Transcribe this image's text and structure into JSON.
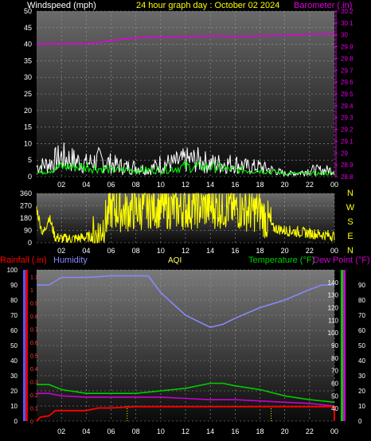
{
  "header": {
    "left": "Windspeed (mph)",
    "center": "24 hour graph day : October 02 2024",
    "right": "Barometer (.in)"
  },
  "mid_header": {
    "rainfall": "Rainfall (.in)",
    "humidity": "Humidity",
    "aqi": "AQI",
    "temperature": "Temperature (°F)",
    "dewpoint": "Dew Point (°F)"
  },
  "colors": {
    "windspeed": "#ffffff",
    "gust": "#00ff00",
    "barometer": "#e000e0",
    "direction": "#ffff00",
    "temperature": "#00cc00",
    "dewpoint": "#cc00cc",
    "humidity": "#8888ff",
    "rain": "#ff0000",
    "aqi": "#ffff00"
  },
  "chart_data": [
    {
      "type": "line",
      "name": "wind-baro",
      "title": "24 hour graph day : October 02 2024",
      "x_ticks": [
        "02",
        "04",
        "06",
        "08",
        "10",
        "12",
        "14",
        "16",
        "18",
        "20",
        "22",
        "00"
      ],
      "left_axis": {
        "label": "Windspeed (mph)",
        "range": [
          0,
          50
        ],
        "ticks": [
          "0",
          "5",
          "10",
          "15",
          "20",
          "25",
          "30",
          "35",
          "40",
          "45",
          "50"
        ]
      },
      "right_axis": {
        "label": "Barometer (.in)",
        "range": [
          28.8,
          30.2
        ],
        "ticks": [
          "28.8",
          "28.9",
          "29",
          "29.1",
          "29.2",
          "29.3",
          "29.4",
          "29.5",
          "29.6",
          "29.7",
          "29.8",
          "29.9",
          "30",
          "30.1",
          "30.2"
        ]
      },
      "series": [
        {
          "axis": "right",
          "hours": [
            0,
            2,
            4,
            6,
            8,
            10,
            12,
            14,
            16,
            18,
            20,
            22,
            24
          ],
          "values": [
            29.92,
            29.925,
            29.925,
            29.95,
            29.975,
            29.98,
            29.985,
            29.99,
            29.985,
            29.99,
            29.995,
            30.005,
            30.01
          ]
        },
        {
          "axis": "left",
          "hours": [
            0,
            1,
            2,
            3,
            4,
            5,
            6,
            7,
            8,
            9,
            10,
            11,
            12,
            13,
            14,
            15,
            16,
            17,
            18,
            19,
            20,
            21,
            22,
            23,
            24
          ],
          "values": [
            3,
            4,
            6,
            5,
            4,
            5,
            4,
            3,
            3,
            2,
            4,
            4,
            5,
            5,
            4,
            4,
            4,
            3,
            3,
            2,
            1,
            1,
            2,
            2,
            2
          ]
        },
        {
          "axis": "left",
          "hours": [
            0,
            2,
            4,
            6,
            8,
            10,
            12,
            14,
            16,
            18,
            20,
            22,
            24
          ],
          "values": [
            1,
            3,
            3,
            2,
            2,
            2,
            3,
            3,
            2,
            2,
            1,
            1,
            1
          ]
        }
      ]
    },
    {
      "type": "line",
      "name": "wind-direction",
      "left_axis": {
        "range": [
          0,
          360
        ],
        "ticks": [
          "0",
          "90",
          "180",
          "270",
          "360"
        ]
      },
      "right_labels": [
        "N",
        "W",
        "S",
        "E",
        "N"
      ],
      "x_ticks": [
        "02",
        "04",
        "06",
        "08",
        "10",
        "12",
        "14",
        "16",
        "18",
        "20",
        "22",
        "00"
      ],
      "series": [
        {
          "hours": [
            0,
            0.5,
            1,
            1.5,
            2,
            3,
            4,
            5,
            6,
            7,
            8,
            9,
            10,
            11,
            12,
            13,
            14,
            15,
            16,
            17,
            18,
            19,
            20,
            21,
            22,
            23,
            24
          ],
          "values": [
            250,
            60,
            190,
            40,
            30,
            30,
            40,
            60,
            250,
            230,
            240,
            260,
            260,
            250,
            250,
            260,
            260,
            255,
            250,
            240,
            230,
            110,
            90,
            80,
            70,
            60,
            50
          ]
        }
      ]
    },
    {
      "type": "line",
      "name": "temp-humidity-rain",
      "x_ticks": [
        "02",
        "04",
        "06",
        "08",
        "10",
        "12",
        "14",
        "16",
        "18",
        "20",
        "22",
        "00"
      ],
      "humidity_axis": {
        "label": "Humidity",
        "range": [
          0,
          100
        ],
        "ticks": [
          "0",
          "10",
          "20",
          "30",
          "40",
          "50",
          "60",
          "70",
          "80",
          "90",
          "100"
        ]
      },
      "rain_axis": {
        "label": "Rainfall (.in)",
        "range": [
          0,
          1.15
        ],
        "ticks": [
          "0",
          "0.1",
          "0.2",
          "0.3",
          "0.4",
          "0.5",
          "0.6",
          "0.7",
          "0.8",
          "0.9",
          "1",
          "1.1"
        ]
      },
      "temp_axis": {
        "label": "Temperature (°F)",
        "range": [
          30,
          150
        ],
        "ticks": [
          "40",
          "50",
          "60",
          "70",
          "80",
          "90",
          "100",
          "110",
          "120",
          "130",
          "140"
        ]
      },
      "dew_axis": {
        "label": "Dew Point (°F)",
        "range": [
          0,
          100
        ],
        "ticks": [
          "0",
          "10",
          "20",
          "30",
          "40",
          "50",
          "60",
          "70",
          "80",
          "90"
        ]
      },
      "series": [
        {
          "scale": "humidity",
          "hours": [
            0,
            1,
            2,
            4,
            6,
            8,
            9,
            10,
            12,
            14,
            15,
            16,
            18,
            20,
            22,
            23,
            24
          ],
          "values": [
            90,
            90,
            95,
            95,
            96,
            96,
            96,
            85,
            70,
            62,
            64,
            68,
            75,
            80,
            87,
            90,
            90
          ]
        },
        {
          "scale": "temp",
          "hours": [
            0,
            1,
            2,
            4,
            6,
            8,
            10,
            12,
            14,
            15,
            16,
            18,
            20,
            22,
            24
          ],
          "values": [
            59,
            59,
            55,
            52,
            52,
            52,
            54,
            56,
            60,
            60,
            58,
            55,
            50,
            47,
            45
          ]
        },
        {
          "scale": "temp",
          "hours": [
            0,
            1,
            2,
            4,
            6,
            8,
            10,
            12,
            14,
            16,
            18,
            20,
            22,
            24
          ],
          "values": [
            52,
            52,
            50,
            49,
            49,
            49,
            49,
            48,
            47,
            47,
            46,
            45,
            44,
            42
          ]
        },
        {
          "scale": "rain",
          "hours": [
            0,
            0.3,
            1,
            1.5,
            2,
            4,
            5,
            6,
            8,
            10,
            12,
            14,
            16,
            18,
            20,
            22,
            24
          ],
          "values": [
            0,
            0.03,
            0.04,
            0.08,
            0.08,
            0.08,
            0.1,
            0.1,
            0.11,
            0.11,
            0.11,
            0.11,
            0.11,
            0.11,
            0.11,
            0.11,
            0.11
          ]
        }
      ]
    }
  ]
}
